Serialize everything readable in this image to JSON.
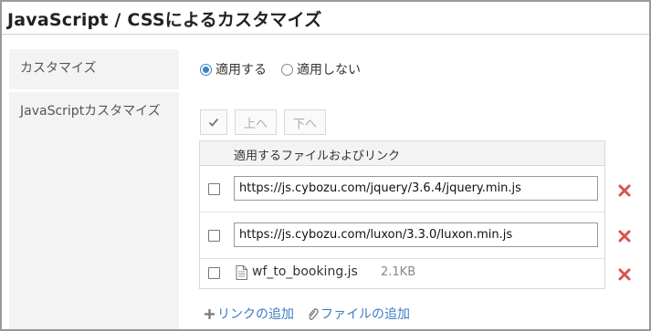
{
  "section": {
    "title": "JavaScript / CSSによるカスタマイズ"
  },
  "customize": {
    "label": "カスタマイズ",
    "options": [
      {
        "label": "適用する",
        "selected": true
      },
      {
        "label": "適用しない",
        "selected": false
      }
    ]
  },
  "js": {
    "label": "JavaScriptカスタマイズ",
    "toolbar": {
      "check_icon": "checkmark-icon",
      "up_label": "上へ",
      "down_label": "下へ"
    },
    "table_header": "適用するファイルおよびリンク",
    "entries": [
      {
        "type": "link",
        "value": "https://js.cybozu.com/jquery/3.6.4/jquery.min.js",
        "checked": false
      },
      {
        "type": "link",
        "value": "https://js.cybozu.com/luxon/3.3.0/luxon.min.js",
        "checked": false
      },
      {
        "type": "file",
        "name": "wf_to_booking.js",
        "size": "2.1KB",
        "checked": false
      }
    ],
    "add_link_label": "リンクの追加",
    "add_file_label": "ファイルの追加"
  },
  "colors": {
    "accent": "#3b7cc4",
    "delete": "#d9534f",
    "label_bg": "#f3f3f3"
  }
}
